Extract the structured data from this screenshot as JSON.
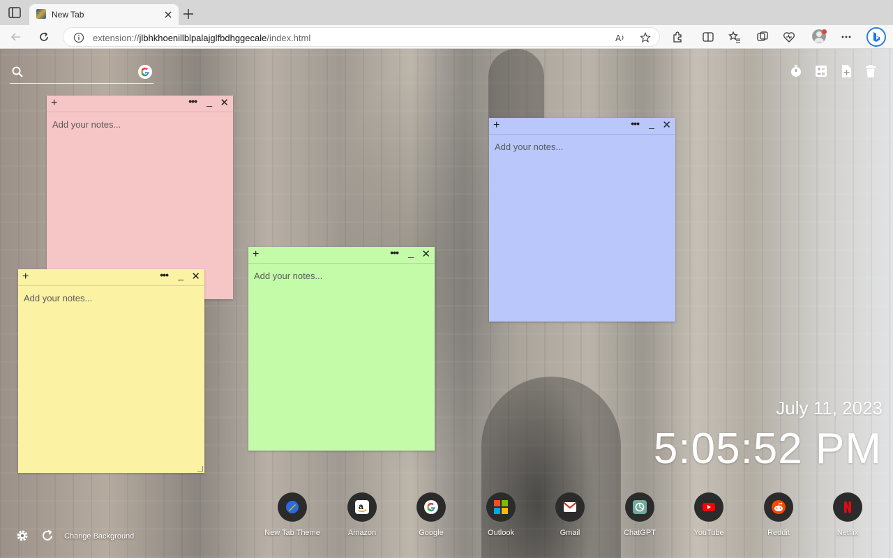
{
  "browser": {
    "tab_title": "New Tab",
    "url_prefix": "extension://",
    "url_host": "jlbhkhoenillblpalajglfbdhggecale",
    "url_path": "/index.html"
  },
  "search": {
    "icon": "search-icon",
    "engine_icon": "google-icon"
  },
  "tools": [
    "timer-icon",
    "calculator-icon",
    "add-note-icon",
    "trash-icon"
  ],
  "notes": [
    {
      "color": "#f6c6c7",
      "placeholder": "Add your notes..."
    },
    {
      "color": "#b9c7fb",
      "placeholder": "Add your notes..."
    },
    {
      "color": "#c4fba9",
      "placeholder": "Add your notes..."
    },
    {
      "color": "#fcf2a4",
      "placeholder": "Add your notes..."
    }
  ],
  "note_controls": {
    "add": "+",
    "more": "•••",
    "minimize": "_",
    "close": "✕"
  },
  "clock": {
    "date": "July 11, 2023",
    "time": "5:05:52 PM"
  },
  "shortcuts": [
    {
      "label": "New Tab Theme"
    },
    {
      "label": "Amazon"
    },
    {
      "label": "Google"
    },
    {
      "label": "Outlook"
    },
    {
      "label": "Gmail"
    },
    {
      "label": "ChatGPT"
    },
    {
      "label": "YouTube"
    },
    {
      "label": "Reddit"
    },
    {
      "label": "Netflix"
    }
  ],
  "footer": {
    "change_background": "Change Background"
  }
}
